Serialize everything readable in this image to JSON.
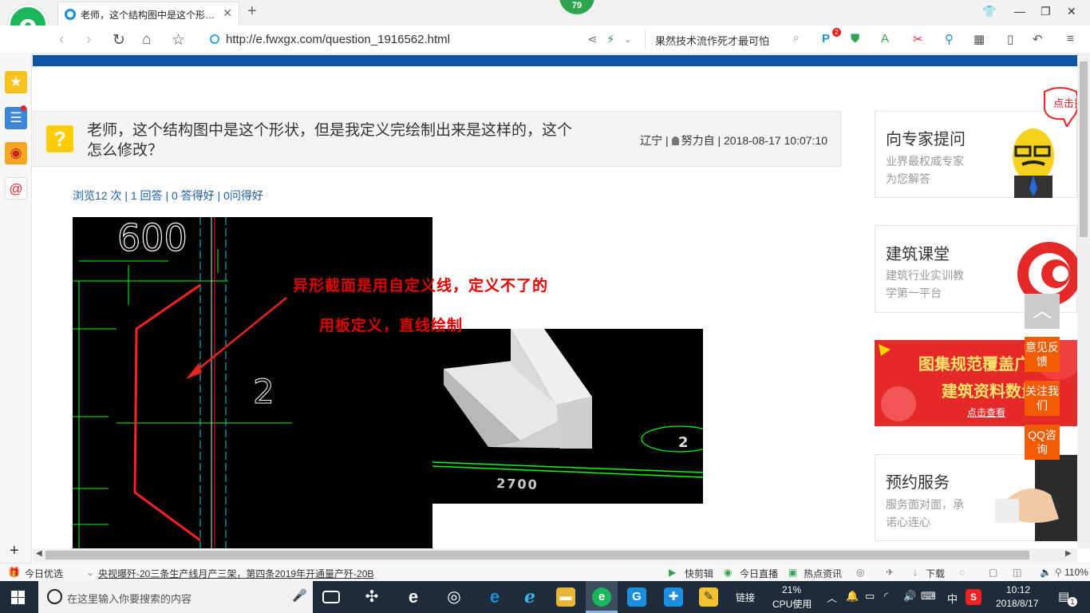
{
  "browser": {
    "tab_title": "老师，这个结构图中是这个形状，但是我定义完绘制出来是这样的，这个怎么修改？",
    "badge_count": "79",
    "url": "http://e.fwxgx.com/question_1916562.html",
    "search_text": "果然技术流作死才最可怕",
    "notif_count": "2"
  },
  "question": {
    "title": "老师，这个结构图中是这个形状，但是我定义完绘制出来是这样的，这个怎么修改？",
    "location": "辽宁",
    "author": "努力自",
    "datetime": "2018-08-17 10:07:10",
    "stats": "浏览12 次 | 1 回答 | 0 答得好 | 0问得好"
  },
  "cad": {
    "dim_top": "600",
    "label_2": "2",
    "dim_bottom": "2700",
    "annotation_line1": "异形截面是用自定义线，定义不了的",
    "annotation_line2": "用板定义，直线绘制"
  },
  "sidebar_cards": [
    {
      "title": "向专家提问",
      "sub1": "业界最权威专家",
      "sub2": "为您解答"
    },
    {
      "title": "建筑课堂",
      "sub1": "建筑行业实训教",
      "sub2": "学第一平台"
    },
    {
      "title": "预约服务",
      "sub1": "服务面对面，承",
      "sub2": "诺心连心"
    }
  ],
  "promo_ad": {
    "line1": "图集规范覆盖广",
    "line2": "建筑资料数量多",
    "line3": "点击查看"
  },
  "speech_bubble": "点击提问",
  "float_buttons": [
    "意见反馈",
    "关注我们",
    "QQ咨询"
  ],
  "status_bar": {
    "today_pick": "今日优选",
    "news": "央视曝歼-20三条生产线月产三架，第四条2019年开通量产歼-20B",
    "quick_clip": "快剪辑",
    "live": "今日直播",
    "hot_news": "热点资讯",
    "download": "下载",
    "zoom": "110%"
  },
  "taskbar": {
    "search_placeholder": "在这里输入你要搜索的内容",
    "links": "链接",
    "cpu_percent": "21%",
    "cpu_label": "CPU使用",
    "ime": "中",
    "time": "10:12",
    "date": "2018/8/17",
    "notifications": "1"
  },
  "colors": {
    "brand_green": "#1bb55c",
    "top_strip": "#0d56a5",
    "float_orange": "#f25c05",
    "annotation_red": "#e00000"
  }
}
